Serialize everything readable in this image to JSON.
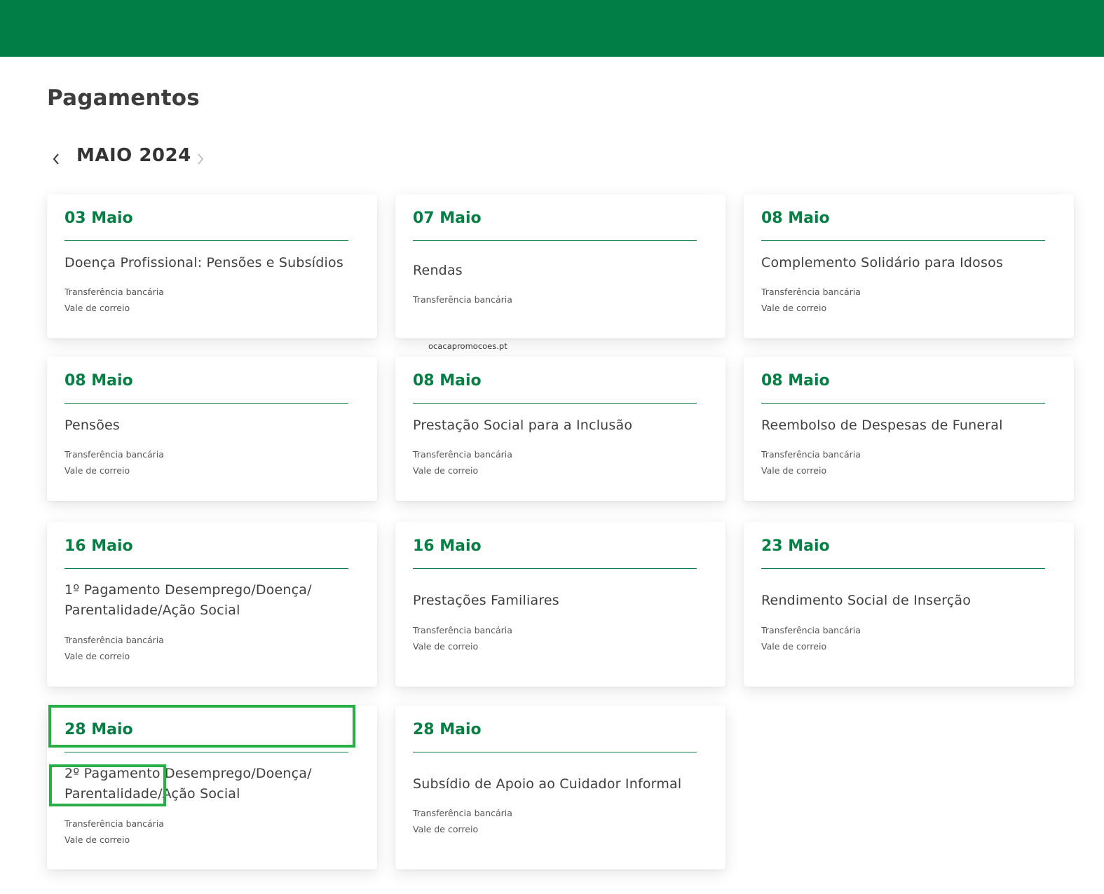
{
  "page": {
    "title": "Pagamentos",
    "month": "MAIO 2024",
    "prev_icon": "chevron-left-icon",
    "next_icon": "chevron-right-icon"
  },
  "colors": {
    "brand": "#017e45",
    "date": "#067f45",
    "highlight": "#27ae47"
  },
  "watermark": "ocacapromocoes.pt",
  "cards": [
    {
      "date": "03 Maio",
      "title": "Doença Profissional: Pensões e Subsídios",
      "methods": [
        "Transferência bancária",
        "Vale de correio"
      ]
    },
    {
      "date": "07 Maio",
      "title": "Rendas",
      "methods": [
        "Transferência bancária"
      ]
    },
    {
      "date": "08 Maio",
      "title": "Complemento Solidário para Idosos",
      "methods": [
        "Transferência bancária",
        "Vale de correio"
      ]
    },
    {
      "date": "08 Maio",
      "title": "Pensões",
      "methods": [
        "Transferência bancária",
        "Vale de correio"
      ]
    },
    {
      "date": "08 Maio",
      "title": "Prestação Social para a Inclusão",
      "methods": [
        "Transferência bancária",
        "Vale de correio"
      ]
    },
    {
      "date": "08 Maio",
      "title": "Reembolso de Despesas de Funeral",
      "methods": [
        "Transferência bancária",
        "Vale de correio"
      ]
    },
    {
      "date": "16 Maio",
      "title": "1º Pagamento Desemprego/Doença/ Parentalidade/Ação Social",
      "methods": [
        "Transferência bancária",
        "Vale de correio"
      ]
    },
    {
      "date": "16 Maio",
      "title": "Prestações Familiares",
      "methods": [
        "Transferência bancária",
        "Vale de correio"
      ]
    },
    {
      "date": "23 Maio",
      "title": "Rendimento Social de Inserção",
      "methods": [
        "Transferência bancária",
        "Vale de correio"
      ]
    },
    {
      "date": "28 Maio",
      "title": "2º Pagamento Desemprego/Doença/ Parentalidade/Ação Social",
      "methods": [
        "Transferência bancária",
        "Vale de correio"
      ]
    },
    {
      "date": "28 Maio",
      "title": "Subsídio de Apoio ao Cuidador Informal",
      "methods": [
        "Transferência bancária",
        "Vale de correio"
      ]
    }
  ]
}
